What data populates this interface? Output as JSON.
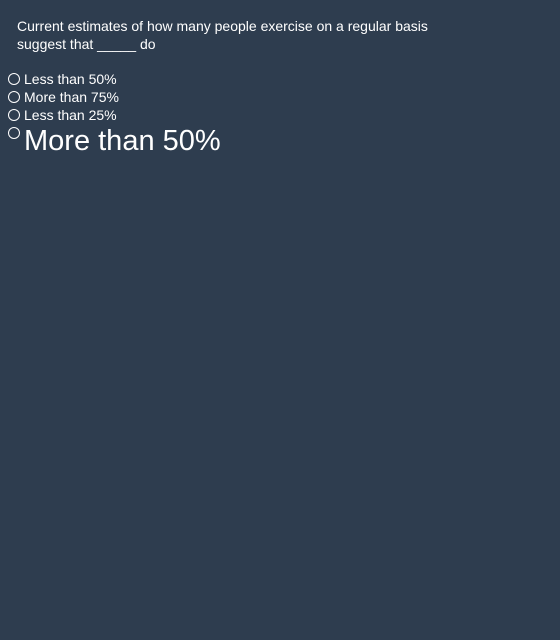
{
  "question": {
    "line1": "Current estimates of how many people exercise on a regular basis",
    "line2": "suggest that _____ do"
  },
  "options": [
    {
      "label": "Less than 50%"
    },
    {
      "label": "More than 75%"
    },
    {
      "label": "Less than 25%"
    },
    {
      "label": "More than 50%"
    }
  ],
  "colors": {
    "background": "#2e3d4f",
    "text": "#ffffff"
  }
}
